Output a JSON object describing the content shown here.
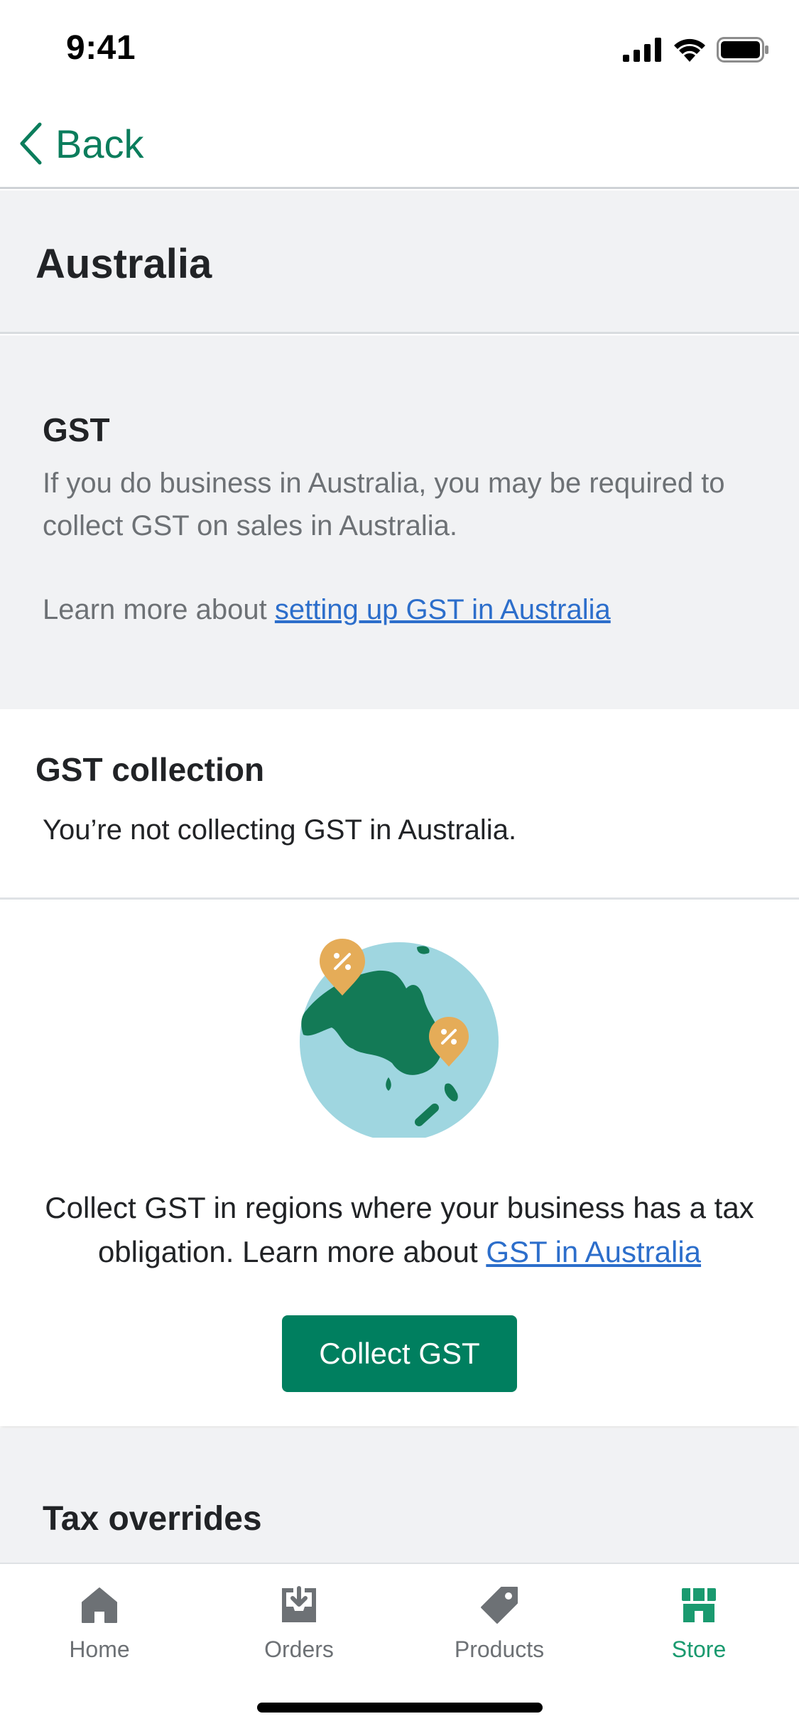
{
  "status_bar": {
    "time": "9:41"
  },
  "nav": {
    "back_label": "Back"
  },
  "page": {
    "title": "Australia"
  },
  "gst_info": {
    "heading": "GST",
    "description": "If you do business in Australia, you may be required to collect GST on sales in Australia.",
    "learn_prefix": "Learn more about ",
    "learn_link": "setting up GST in Australia"
  },
  "collection": {
    "heading": "GST collection",
    "status": "You’re not collecting GST in Australia."
  },
  "promo": {
    "text_prefix": "Collect GST in regions where your business has a tax obligation. Learn more about ",
    "link": "GST in Australia",
    "button_label": "Collect GST"
  },
  "overrides": {
    "heading": "Tax overrides"
  },
  "tabs": [
    {
      "label": "Home",
      "icon": "home-icon",
      "active": false
    },
    {
      "label": "Orders",
      "icon": "orders-icon",
      "active": false
    },
    {
      "label": "Products",
      "icon": "tag-icon",
      "active": false
    },
    {
      "label": "Store",
      "icon": "store-icon",
      "active": true
    }
  ],
  "colors": {
    "accent": "#007f5f",
    "link": "#2c6ecb",
    "active_tab": "#1a9a6f",
    "muted_text": "#6d7175",
    "background": "#f1f2f4"
  }
}
